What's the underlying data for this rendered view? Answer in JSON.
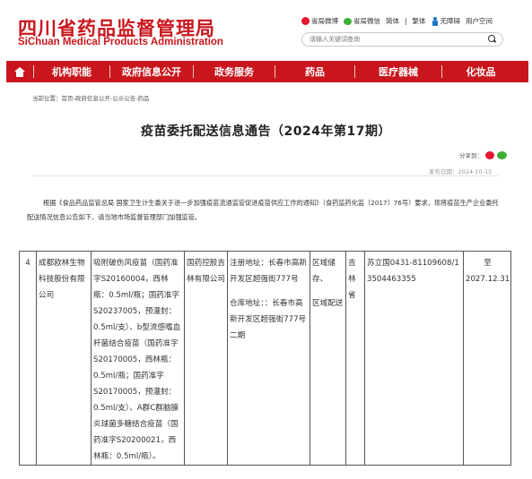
{
  "site": {
    "name_cn": "四川省药品监督管理局",
    "name_en": "SiChuan Medical Products Administration"
  },
  "toplinks": {
    "weibo": "省局微博",
    "wechat": "省局微信",
    "simplified": "简体",
    "traditional": "繁体",
    "accessibility": "无障碍",
    "user_space": "用户空间"
  },
  "search": {
    "placeholder": "请输入关键词查询"
  },
  "nav": {
    "home": "home-icon",
    "items": [
      "机构职能",
      "政府信息公开",
      "政务服务",
      "药品",
      "医疗器械",
      "化妆品"
    ]
  },
  "breadcrumb": "当前位置：首页-政府信息公开-公示公告-药品",
  "article": {
    "title": "疫苗委托配送信息通告（2024年第17期）",
    "share_label": "分享到：",
    "pub_date": "发布日期：2024-10-15",
    "body": "根据《食品药品监管总局 国家卫生计生委关于进一步加强疫苗流通监管促进疫苗供应工作的通知》（食药监药化监〔2017〕76号）要求，现将疫苗生产企业委托配送情况信息公告如下，请当地市场监督管理部门加强监管。"
  },
  "table": {
    "rows": [
      {
        "no": "4",
        "company": "成都欧林生物科技股份有限公司",
        "vaccine": "吸附破伤风疫苗（国药准字S20160004，西林瓶：0.5ml/瓶；国药准字S20237005，预灌封：0.5ml/支）、b型流感嗜血杆菌结合疫苗（国药准字S20170005，西林瓶：0.5ml/瓶；国药准字S20170005，预灌封：0.5ml/支）、A群C群脑膜炎球菌多糖结合疫苗（国药准字S20200021，西林瓶：0.5ml/瓶）。",
        "distributor": "国药控股吉林有限公司",
        "address_reg": "注册地址：长春市高新开发区超强街777号",
        "address_wh": "仓库地址：：长春市高新开发区超强街777号二期",
        "area_1": "区域储存、",
        "area_2": "区域配送",
        "province": "吉林省",
        "permit": "苏立国0431-81109608/13504463355",
        "valid": "至2027.12.31"
      }
    ]
  },
  "colors": {
    "brand_red": "#c9161d",
    "weibo": "#e6162d",
    "wechat": "#3cb034"
  }
}
